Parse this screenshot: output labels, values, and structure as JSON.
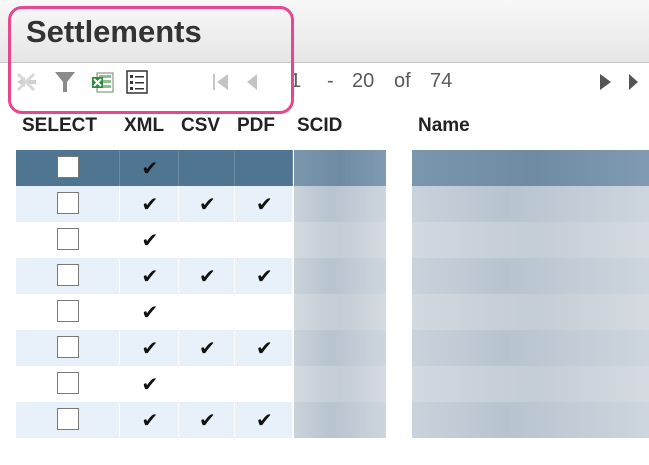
{
  "panel": {
    "title": "Settlements"
  },
  "toolbar": {
    "icons": [
      "clear-filter-icon",
      "filter-icon",
      "excel-export-icon",
      "column-list-icon",
      "first-page-icon",
      "prev-page-icon",
      "next-page-icon",
      "last-page-icon"
    ],
    "pager": {
      "from": "1",
      "dash": "-",
      "to": "20",
      "of_label": "of",
      "total": "74"
    }
  },
  "grid": {
    "columns": [
      "SELECT",
      "XML",
      "CSV",
      "PDF",
      "SCID",
      "Name"
    ],
    "rows": [
      {
        "selected": true,
        "xml": "✔",
        "csv": "",
        "pdf": ""
      },
      {
        "selected": false,
        "xml": "✔",
        "csv": "✔",
        "pdf": "✔"
      },
      {
        "selected": false,
        "xml": "✔",
        "csv": "",
        "pdf": ""
      },
      {
        "selected": false,
        "xml": "✔",
        "csv": "✔",
        "pdf": "✔"
      },
      {
        "selected": false,
        "xml": "✔",
        "csv": "",
        "pdf": ""
      },
      {
        "selected": false,
        "xml": "✔",
        "csv": "✔",
        "pdf": "✔"
      },
      {
        "selected": false,
        "xml": "✔",
        "csv": "",
        "pdf": ""
      },
      {
        "selected": false,
        "xml": "✔",
        "csv": "✔",
        "pdf": "✔"
      }
    ]
  },
  "colors": {
    "selected_row": "#4f7591",
    "alt_row": "#e8f1fa",
    "highlight": "#e8468e"
  }
}
